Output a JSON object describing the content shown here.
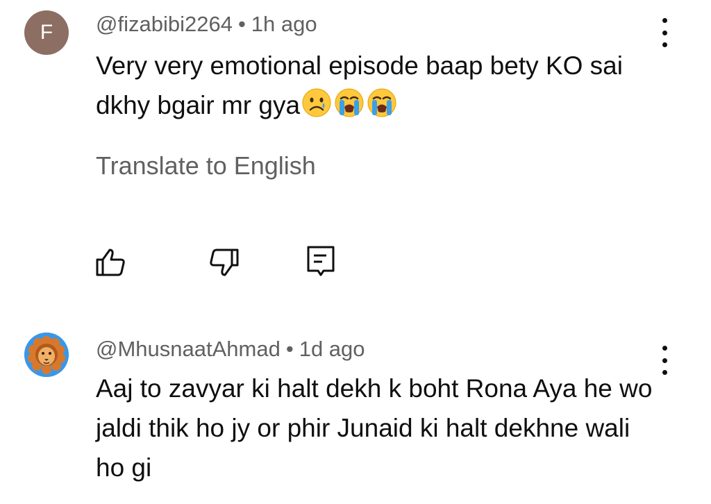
{
  "comments": [
    {
      "avatar_letter": "F",
      "avatar_color": "#8d6e63",
      "author": "@fizabibi2264",
      "separator": "•",
      "time": "1h ago",
      "text": "Very very emotional episode baap bety KO sai dkhy bgair mr gya",
      "emojis": [
        "sad-face",
        "crying-face",
        "crying-face"
      ],
      "translate_label": "Translate to English",
      "actions": [
        "thumbs-up-icon",
        "thumbs-down-icon",
        "reply-icon"
      ]
    },
    {
      "avatar_image": "lion-avatar",
      "author": "@MhusnaatAhmad",
      "separator": "•",
      "time": "1d ago",
      "text": "Aaj to zavyar ki halt dekh k boht Rona Aya he wo jaldi thik ho jy or phir Junaid ki halt dekhne wali ho gi"
    }
  ],
  "colors": {
    "secondary_text": "#606060",
    "primary_text": "#0f0f0f",
    "emoji_yellow": "#ffc83d",
    "tear_blue": "#3aa0e8"
  }
}
